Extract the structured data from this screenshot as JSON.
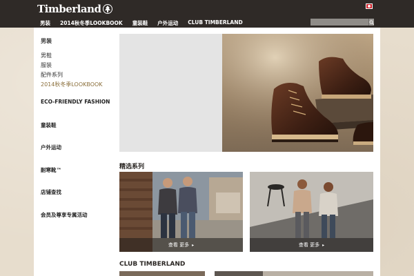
{
  "brand": {
    "logo_text": "Timberland"
  },
  "nav": {
    "items": [
      "男装",
      "2014秋冬季LOOKBOOK",
      "童装鞋",
      "户外运动",
      "CLUB TIMBERLAND"
    ]
  },
  "search": {
    "placeholder": ""
  },
  "sidebar": {
    "top_label": "男装",
    "sub_items": [
      "男鞋",
      "服装",
      "配件系列",
      "2014秋冬季LOOKBOOK"
    ],
    "sections": [
      "ECO-FRIENDLY FASHION",
      "童装鞋",
      "户外运动",
      "耐寒靴™",
      "店铺查找",
      "会员及尊享专属活动"
    ]
  },
  "main": {
    "section_title": "精选系列",
    "cards": [
      {
        "label": "查看 更多",
        "arrow": "▸"
      },
      {
        "label": "查看 更多",
        "arrow": "▸"
      }
    ],
    "club_title": "CLUB TIMBERLAND"
  },
  "colors": {
    "header_bg": "#2f2a27",
    "accent": "#8a6e3a",
    "flag": "#d0202a"
  },
  "icons": [
    "timberland-tree-icon",
    "china-flag-icon",
    "search-icon",
    "chevron-right-icon"
  ]
}
